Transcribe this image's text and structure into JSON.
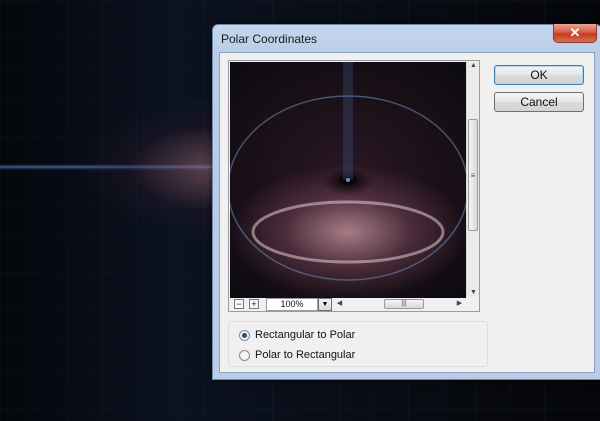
{
  "dialog": {
    "title": "Polar Coordinates",
    "close_glyph": "✕"
  },
  "buttons": {
    "ok_label": "OK",
    "cancel_label": "Cancel"
  },
  "preview": {
    "zoom_out_glyph": "−",
    "zoom_in_glyph": "+",
    "zoom_value": "100%",
    "dropdown_glyph": "▼",
    "scroll_up_glyph": "▲",
    "scroll_down_glyph": "▼",
    "scroll_left_glyph": "◀",
    "scroll_right_glyph": "▶",
    "vthumb_grip": "≡",
    "hthumb_grip": "|||"
  },
  "options": [
    {
      "label": "Rectangular to Polar",
      "selected": true
    },
    {
      "label": "Polar to Rectangular",
      "selected": false
    }
  ],
  "colors": {
    "accent": "#3c7fb1",
    "close_red": "#c33d23",
    "frame": "#b9cde8"
  }
}
